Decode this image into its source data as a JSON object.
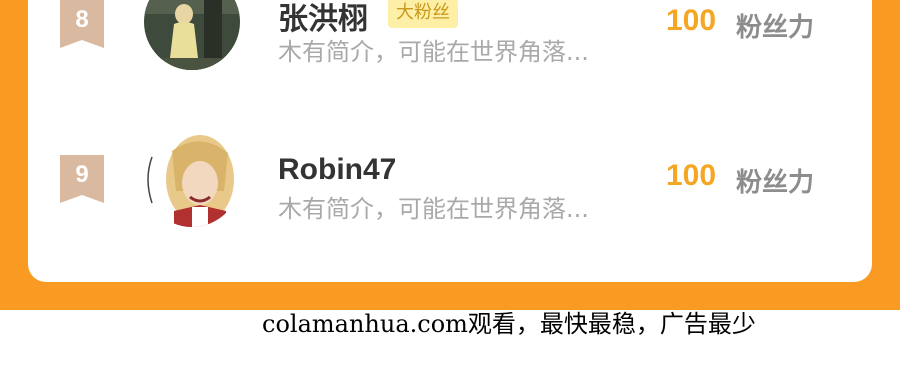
{
  "rows": [
    {
      "rank": "8",
      "name": "张洪栩",
      "tag": "大粉丝",
      "bio": "木有简介，可能在世界角落...",
      "score": "100",
      "score_unit": "粉丝力",
      "avatar_icon": "child-photo-avatar"
    },
    {
      "rank": "9",
      "name": "Robin47",
      "bio": "木有简介，可能在世界角落...",
      "score": "100",
      "score_unit": "粉丝力",
      "avatar_icon": "anime-character-avatar"
    }
  ],
  "watermark": "colamanhua.com观看，最快最稳，广告最少",
  "colors": {
    "background_orange": "#f99a22",
    "badge": "#d9b9a0",
    "score": "#f5a623",
    "tag_bg": "#fdf0a6"
  }
}
